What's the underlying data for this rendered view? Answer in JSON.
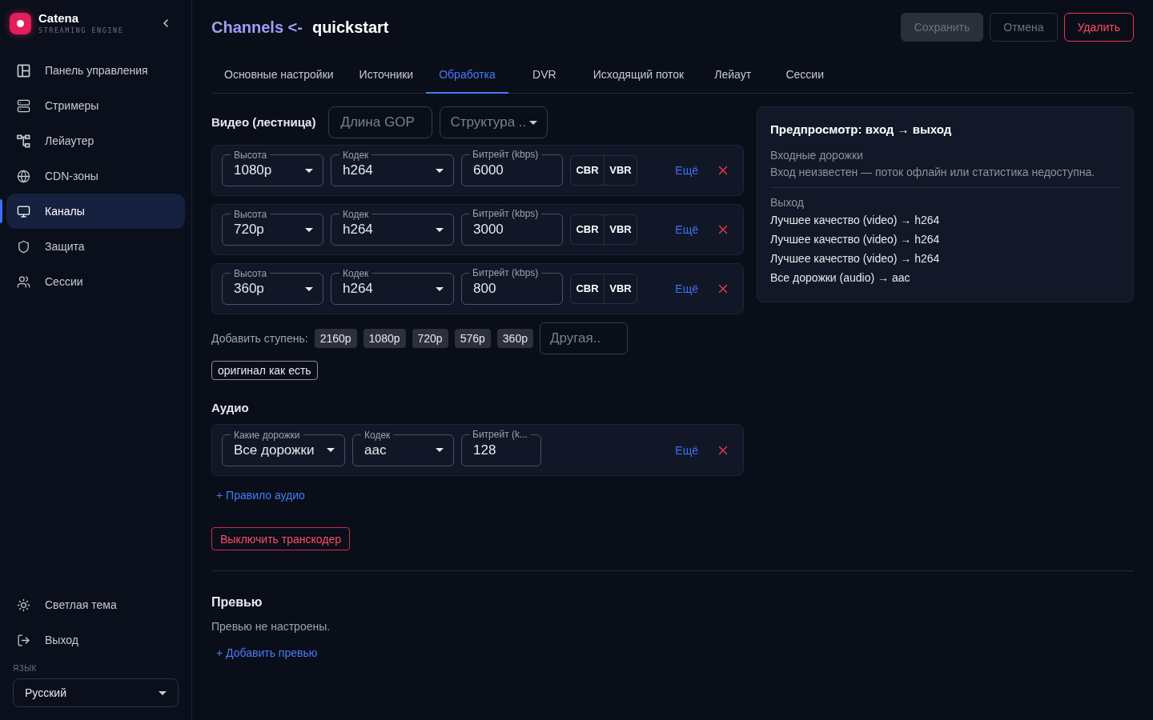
{
  "sidebar": {
    "brand": {
      "name": "Catena",
      "tagline": "STREAMING ENGINE"
    },
    "nav": [
      {
        "label": "Панель управления",
        "selected": false
      },
      {
        "label": "Стримеры",
        "selected": false
      },
      {
        "label": "Лейаутер",
        "selected": false
      },
      {
        "label": "CDN-зоны",
        "selected": false
      },
      {
        "label": "Каналы",
        "selected": true
      },
      {
        "label": "Защита",
        "selected": false
      },
      {
        "label": "Сессии",
        "selected": false
      }
    ],
    "footer": [
      {
        "label": "Светлая тема"
      },
      {
        "label": "Выход"
      }
    ],
    "language": {
      "label": "ЯЗЫК",
      "value": "Русский"
    }
  },
  "header": {
    "breadcrumb": "Channels <-",
    "title": "quickstart",
    "buttons": [
      {
        "label": "Сохранить",
        "kind": "primary",
        "disabled": true
      },
      {
        "label": "Отмена",
        "kind": "outline",
        "disabled": true
      },
      {
        "label": "Удалить",
        "kind": "danger",
        "disabled": false
      }
    ]
  },
  "tabs": [
    {
      "label": "Основные настройки",
      "selected": false
    },
    {
      "label": "Источники",
      "selected": false
    },
    {
      "label": "Обработка",
      "selected": true
    },
    {
      "label": "DVR",
      "selected": false
    },
    {
      "label": "Исходящий поток",
      "selected": false
    },
    {
      "label": "Лейаут",
      "selected": false
    },
    {
      "label": "Сессии",
      "selected": false
    }
  ],
  "video": {
    "title": "Видео (лестница)",
    "gop": {
      "placeholder": "Длина GOP"
    },
    "structure": {
      "placeholder": "Структура .."
    },
    "rungs": [
      {
        "height": {
          "label": "Высота",
          "value": "1080p"
        },
        "codec": {
          "label": "Кодек",
          "value": "h264"
        },
        "bitrate": {
          "label": "Битрейт (kbps)",
          "value": "6000"
        },
        "modes": [
          "CBR",
          "VBR"
        ],
        "more": "Ещё"
      },
      {
        "height": {
          "label": "Высота",
          "value": "720p"
        },
        "codec": {
          "label": "Кодек",
          "value": "h264"
        },
        "bitrate": {
          "label": "Битрейт (kbps)",
          "value": "3000"
        },
        "modes": [
          "CBR",
          "VBR"
        ],
        "more": "Ещё"
      },
      {
        "height": {
          "label": "Высота",
          "value": "360p"
        },
        "codec": {
          "label": "Кодек",
          "value": "h264"
        },
        "bitrate": {
          "label": "Битрейт (kbps)",
          "value": "800"
        },
        "modes": [
          "CBR",
          "VBR"
        ],
        "more": "Ещё"
      }
    ],
    "add_step": {
      "label": "Добавить ступень:",
      "presets": [
        "2160p",
        "1080p",
        "720p",
        "576p",
        "360p"
      ],
      "other": {
        "placeholder": "Другая.."
      },
      "original": "оригинал как есть"
    }
  },
  "audio": {
    "title": "Аудио",
    "rules": [
      {
        "tracks": {
          "label": "Какие дорожки",
          "value": "Все дорожки"
        },
        "codec": {
          "label": "Кодек",
          "value": "aac"
        },
        "bitrate": {
          "label": "Битрейт (k...",
          "value": "128"
        },
        "more": "Ещё"
      }
    ],
    "add_link": "+ Правило аудио"
  },
  "disable_button": "Выключить транскодер",
  "io_preview": {
    "title": "Предпросмотр: вход → выход",
    "input_label": "Входные дорожки",
    "input_text": "Вход неизвестен — поток офлайн или статистика недоступна.",
    "output_label": "Выход",
    "outputs": [
      "Лучшее качество (video) → h264",
      "Лучшее качество (video) → h264",
      "Лучшее качество (video) → h264",
      "Все дорожки (audio) → aac"
    ]
  },
  "previews": {
    "title": "Превью",
    "empty": "Превью не настроены.",
    "add_link": "+ Добавить превью"
  }
}
